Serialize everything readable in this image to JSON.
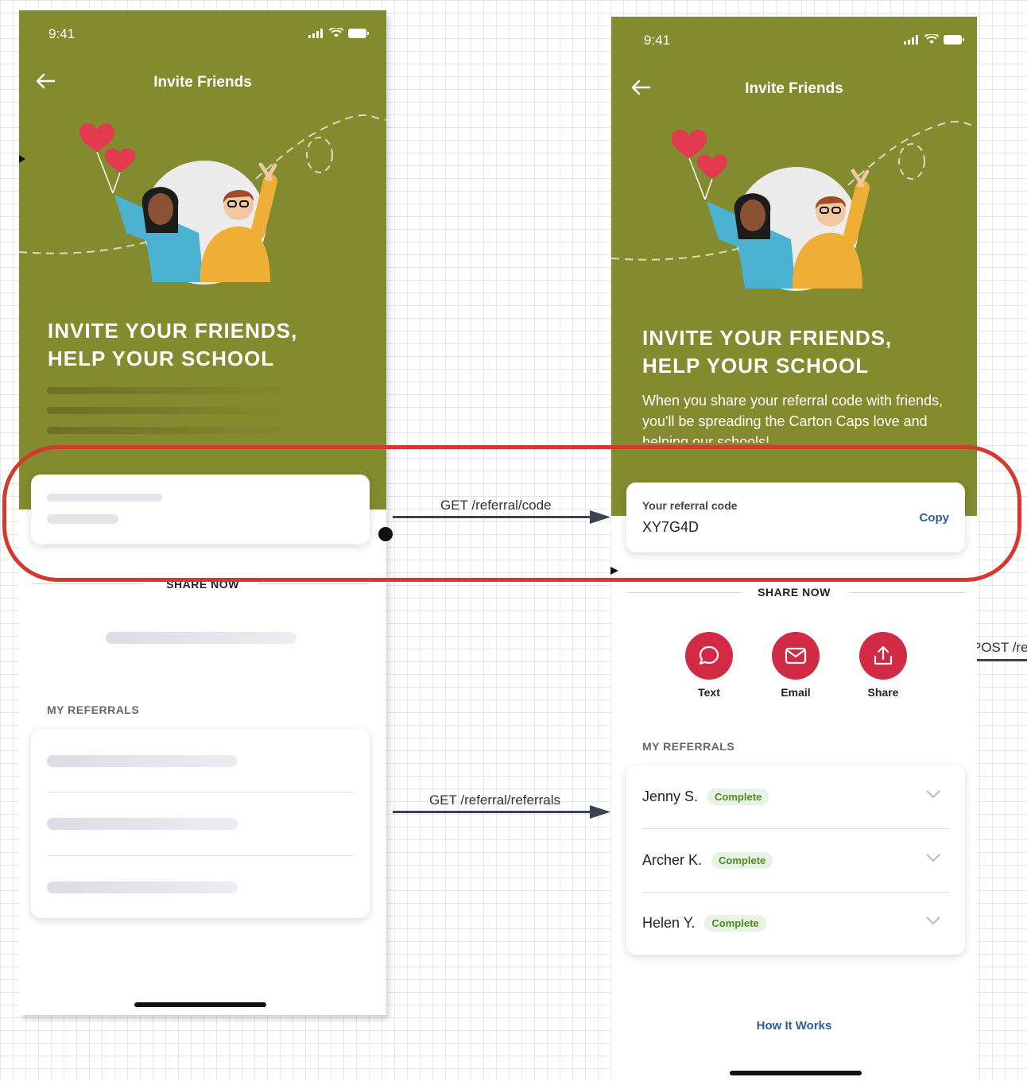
{
  "colors": {
    "hero": "#838b2f",
    "accent": "#d02a45",
    "badge_bg": "#e7f3e3",
    "badge_text": "#4f8a2b",
    "highlight": "#d33a2d",
    "link": "#2c5f99"
  },
  "left_screen": {
    "status_time": "9:41",
    "nav_title": "Invite Friends",
    "headline_line1": "INVITE YOUR FRIENDS,",
    "headline_line2": "HELP YOUR SCHOOL",
    "share_heading": "SHARE NOW",
    "referrals_heading": "MY REFERRALS"
  },
  "right_screen": {
    "status_time": "9:41",
    "nav_title": "Invite Friends",
    "headline_line1": "INVITE YOUR FRIENDS,",
    "headline_line2": "HELP YOUR SCHOOL",
    "description": "When you share your referral code with friends, you'll be spreading the Carton Caps love and helping our schools!",
    "referral_card": {
      "label": "Your referral code",
      "code": "XY7G4D",
      "copy_label": "Copy"
    },
    "share_heading": "SHARE NOW",
    "share_buttons": [
      {
        "label": "Text",
        "icon": "chat-bubble-icon"
      },
      {
        "label": "Email",
        "icon": "envelope-icon"
      },
      {
        "label": "Share",
        "icon": "share-upload-icon"
      }
    ],
    "referrals_heading": "MY REFERRALS",
    "referrals": [
      {
        "name": "Jenny S.",
        "status": "Complete"
      },
      {
        "name": "Archer K.",
        "status": "Complete"
      },
      {
        "name": "Helen Y.",
        "status": "Complete"
      }
    ],
    "how_it_works": "How It Works"
  },
  "api_calls": {
    "code": "GET /referral/code",
    "referrals": "GET /referral/referrals",
    "partial": "POST /re"
  }
}
